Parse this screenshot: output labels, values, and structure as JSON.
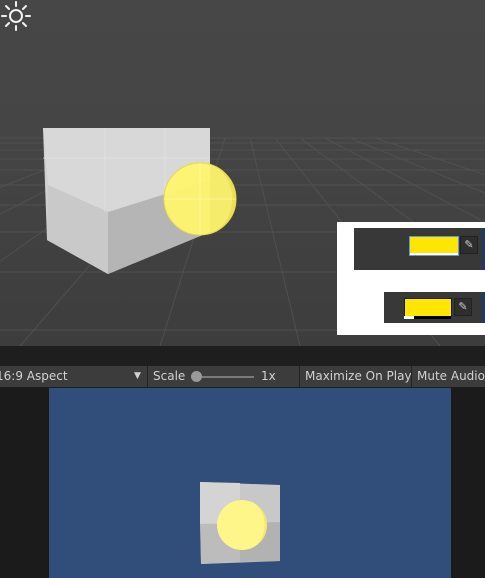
{
  "scene": {
    "sun_icon": "sun-icon",
    "color_fields": [
      {
        "color": "#FFE600",
        "picker_icon": "eyedropper-icon"
      },
      {
        "color": "#FFE600",
        "picker_icon": "eyedropper-icon"
      }
    ]
  },
  "game_toolbar": {
    "aspect_label": "16:9 Aspect",
    "scale_label": "Scale",
    "scale_value": "1x",
    "maximize_label": "Maximize On Play",
    "mute_label": "Mute Audio"
  },
  "colors": {
    "game_background": "#314D79",
    "sphere": "#FFF47A",
    "cube": "#D9D9D9"
  }
}
